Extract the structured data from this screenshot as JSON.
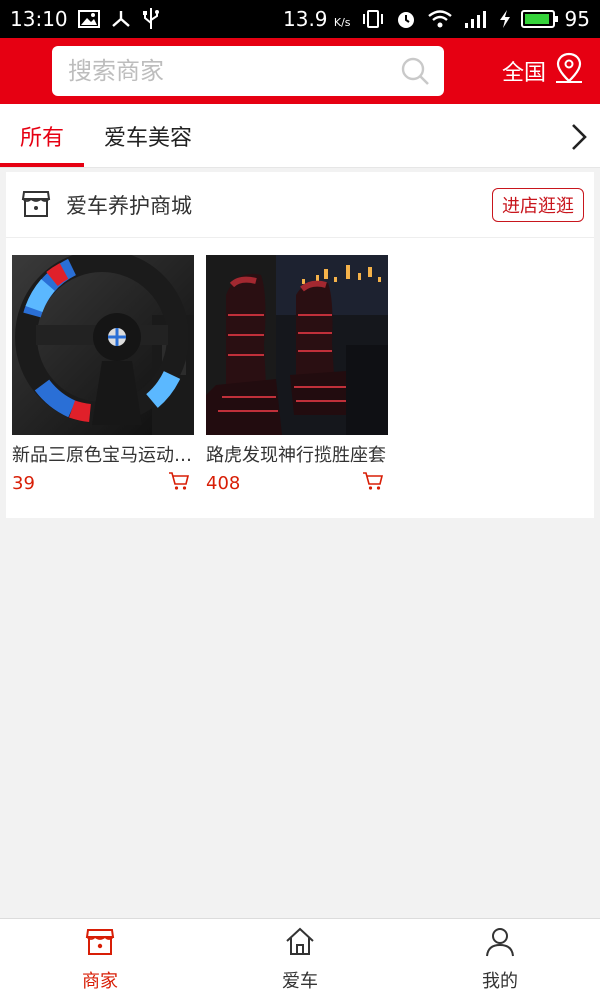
{
  "status_bar": {
    "time": "13:10",
    "speed": "13.9",
    "speed_unit": "K/s",
    "battery": "95",
    "battery_level": 0.95,
    "icons": [
      "image-icon",
      "share-icon",
      "usb-icon",
      "vibrate-icon",
      "alarm-icon",
      "wifi-icon",
      "signal-4g-icon",
      "charging-icon"
    ]
  },
  "header": {
    "search_placeholder": "搜索商家",
    "region_label": "全国",
    "accent": "#e60012"
  },
  "tabs": [
    {
      "label": "所有",
      "active": true
    },
    {
      "label": "爱车美容",
      "active": false
    }
  ],
  "store": {
    "name": "爱车养护商城",
    "visit_label": "进店逛逛",
    "products": [
      {
        "title": "新品三原色宝马运动方向盘套",
        "price": "39",
        "image": "steering-wheel-cover"
      },
      {
        "title": "路虎发现神行揽胜座套",
        "price": "408",
        "image": "car-seat-covers"
      }
    ]
  },
  "bottom_nav": [
    {
      "label": "商家",
      "icon": "store-icon",
      "active": true
    },
    {
      "label": "爱车",
      "icon": "home-icon",
      "active": false
    },
    {
      "label": "我的",
      "icon": "user-icon",
      "active": false
    }
  ]
}
